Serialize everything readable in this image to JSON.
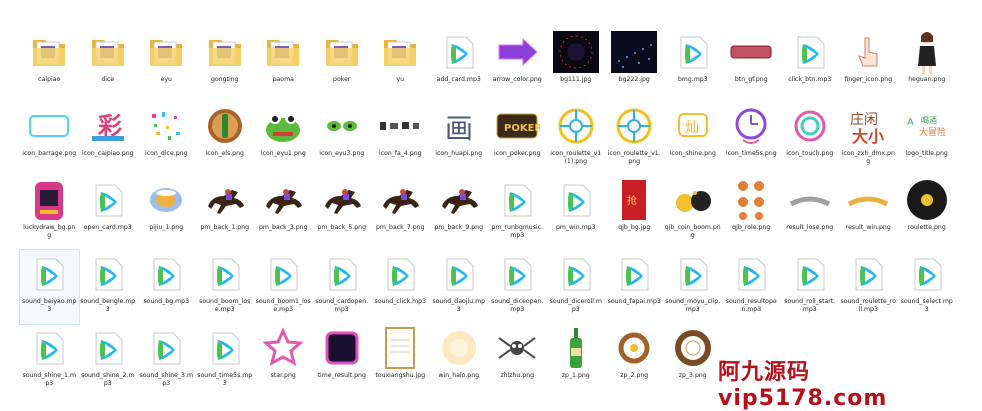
{
  "files": [
    [
      {
        "name": "caipiao",
        "kind": "folder"
      },
      {
        "name": "dice",
        "kind": "folder"
      },
      {
        "name": "eyu",
        "kind": "folder"
      },
      {
        "name": "gongting",
        "kind": "folder"
      },
      {
        "name": "paoma",
        "kind": "folder"
      },
      {
        "name": "poker",
        "kind": "folder"
      },
      {
        "name": "yu",
        "kind": "folder"
      },
      {
        "name": "add_card.mp3",
        "kind": "audio"
      },
      {
        "name": "arrow_color.png",
        "kind": "arrow"
      },
      {
        "name": "bg111.jpg",
        "kind": "darkbg"
      },
      {
        "name": "bg222.jpg",
        "kind": "darkbg2"
      },
      {
        "name": "bmg.mp3",
        "kind": "audio"
      },
      {
        "name": "btn_gf.png",
        "kind": "btn"
      },
      {
        "name": "click_btn.mp3",
        "kind": "audio"
      },
      {
        "name": "finger_icon.png",
        "kind": "finger"
      },
      {
        "name": "heguan.png",
        "kind": "person"
      }
    ],
    [
      {
        "name": "icon_barrage.png",
        "kind": "barrage"
      },
      {
        "name": "icon_caipiao.png",
        "kind": "caipiaoicon"
      },
      {
        "name": "icon_dice.png",
        "kind": "confetti"
      },
      {
        "name": "icon_els.png",
        "kind": "bottlecircle"
      },
      {
        "name": "icon_eyu1.png",
        "kind": "croc"
      },
      {
        "name": "icon_eyu3.png",
        "kind": "croceyes"
      },
      {
        "name": "icon_fa_4.png",
        "kind": "smallicons"
      },
      {
        "name": "icon_huapi.png",
        "kind": "calligraphy"
      },
      {
        "name": "icon_poker.png",
        "kind": "poker"
      },
      {
        "name": "icon_roulette_v1 (1).png",
        "kind": "wheel"
      },
      {
        "name": "icon_roulette_v1.png",
        "kind": "wheel"
      },
      {
        "name": "icon_shine.png",
        "kind": "shine"
      },
      {
        "name": "icon_time5s.png",
        "kind": "clock"
      },
      {
        "name": "icon_touch.png",
        "kind": "touch"
      },
      {
        "name": "icon_zxh_dmx.png",
        "kind": "zxh"
      },
      {
        "name": "logo_title.png",
        "kind": "logo"
      }
    ],
    [
      {
        "name": "luckydraw_bg.png",
        "kind": "machine"
      },
      {
        "name": "open_card.mp3",
        "kind": "audio"
      },
      {
        "name": "pijiu_1.png",
        "kind": "beer"
      },
      {
        "name": "pm_back_1.png",
        "kind": "horse"
      },
      {
        "name": "pm_back_3.png",
        "kind": "horse"
      },
      {
        "name": "pm_back_5.png",
        "kind": "horse"
      },
      {
        "name": "pm_back_7.png",
        "kind": "horse"
      },
      {
        "name": "pm_back_9.png",
        "kind": "horse"
      },
      {
        "name": "pm_runbgmusic.mp3",
        "kind": "audio"
      },
      {
        "name": "pm_win.mp3",
        "kind": "audio"
      },
      {
        "name": "qjb_bg.jpg",
        "kind": "redenv"
      },
      {
        "name": "qjb_coin_boom.png",
        "kind": "coins"
      },
      {
        "name": "qjb_role.png",
        "kind": "roles"
      },
      {
        "name": "result_lose.png",
        "kind": "lose"
      },
      {
        "name": "result_win.png",
        "kind": "win"
      },
      {
        "name": "roulette.png",
        "kind": "record"
      }
    ],
    [
      {
        "name": "sound_beiyao.mp3",
        "kind": "audio",
        "selected": true
      },
      {
        "name": "sound_bengle.mp3",
        "kind": "audio"
      },
      {
        "name": "sound_bg.mp3",
        "kind": "audio"
      },
      {
        "name": "sound_boom_lose.mp3",
        "kind": "audio"
      },
      {
        "name": "sound_boom1_lose.mp3",
        "kind": "audio"
      },
      {
        "name": "sound_cardopen.mp3",
        "kind": "audio"
      },
      {
        "name": "sound_click.mp3",
        "kind": "audio"
      },
      {
        "name": "sound_daojiu.mp3",
        "kind": "audio"
      },
      {
        "name": "sound_diceopen.mp3",
        "kind": "audio"
      },
      {
        "name": "sound_diceroll.mp3",
        "kind": "audio"
      },
      {
        "name": "sound_fapai.mp3",
        "kind": "audio"
      },
      {
        "name": "sound_moyu_clip.mp3",
        "kind": "audio"
      },
      {
        "name": "sound_resultopen.mp3",
        "kind": "audio"
      },
      {
        "name": "sound_roll_start.mp3",
        "kind": "audio"
      },
      {
        "name": "sound_roulette_roll.mp3",
        "kind": "audio"
      },
      {
        "name": "sound_select.mp3",
        "kind": "audio"
      }
    ],
    [
      {
        "name": "sound_shine_1.mp3",
        "kind": "audio"
      },
      {
        "name": "sound_shine_2.mp3",
        "kind": "audio"
      },
      {
        "name": "sound_shine_3.mp3",
        "kind": "audio"
      },
      {
        "name": "sound_time5s.mp3",
        "kind": "audio"
      },
      {
        "name": "star.png",
        "kind": "star"
      },
      {
        "name": "time_result.png",
        "kind": "frame"
      },
      {
        "name": "touxiangshu.jpg",
        "kind": "certificate"
      },
      {
        "name": "win_halo.png",
        "kind": "halo"
      },
      {
        "name": "zhizhu.png",
        "kind": "spider"
      },
      {
        "name": "zp_1.png",
        "kind": "bottle"
      },
      {
        "name": "zp_2.png",
        "kind": "ring"
      },
      {
        "name": "zp_3.png",
        "kind": "ring2"
      }
    ]
  ],
  "watermark": "阿九源码 vip5178.com"
}
